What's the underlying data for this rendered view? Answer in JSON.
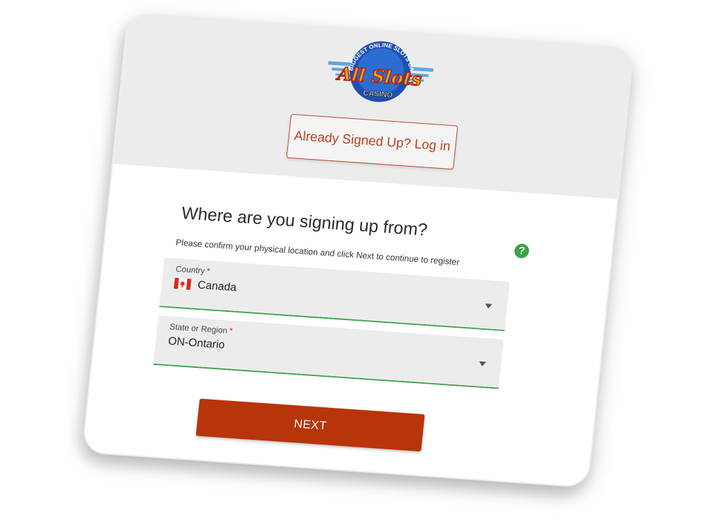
{
  "brand": {
    "logo_words": "All Slots",
    "logo_arc": "BIGGEST ONLINE SLOTS CASINO",
    "logo_sub": "CASINO"
  },
  "header": {
    "login_label": "Already Signed Up? Log in"
  },
  "form": {
    "heading": "Where are you signing up from?",
    "subtitle": "Please confirm your physical location and click Next to continue to register",
    "country": {
      "label": "Country",
      "required_mark": "*",
      "value": "Canada"
    },
    "region": {
      "label": "State or Region",
      "required_mark": "*",
      "value": "ON-Ontario"
    },
    "next_label": "NEXT",
    "help_glyph": "?"
  },
  "colors": {
    "accent": "#b8340a",
    "valid": "#3aa34a",
    "band": "#ececec"
  }
}
